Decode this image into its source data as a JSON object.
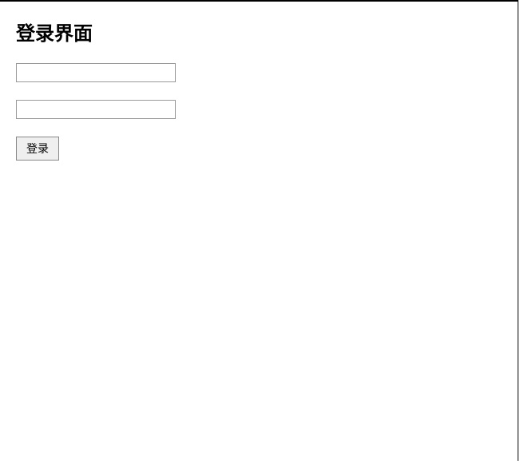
{
  "form": {
    "title": "登录界面",
    "username_value": "",
    "password_value": "",
    "login_label": "登录"
  }
}
